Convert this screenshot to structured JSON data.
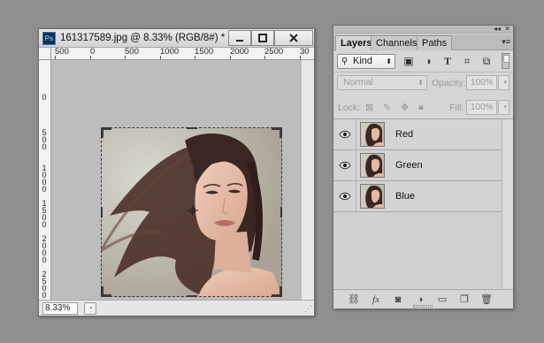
{
  "document": {
    "title": "161317589.jpg @ 8.33% (RGB/8#) *",
    "ruler_h_labels": [
      "500",
      "0",
      "500",
      "1000",
      "1500",
      "2000",
      "2500",
      "30"
    ],
    "ruler_v_labels": [
      "0",
      "500",
      "1000",
      "1500",
      "2000",
      "2500"
    ],
    "zoom": "8.33%"
  },
  "layers_panel": {
    "tabs": [
      "Layers",
      "Channels",
      "Paths"
    ],
    "filter_kind": "Kind",
    "blend_mode": "Normal",
    "opacity_label": "Opacity:",
    "opacity_value": "100%",
    "lock_label": "Lock:",
    "fill_label": "Fill:",
    "fill_value": "100%",
    "layers": [
      {
        "name": "Red",
        "visible": true
      },
      {
        "name": "Green",
        "visible": true
      },
      {
        "name": "Blue",
        "visible": true
      }
    ]
  },
  "colors": {
    "background": "#8f8f8f",
    "panel": "#d6d6d6",
    "photo_hair": "#3a2622",
    "photo_skin": "#e3b9a4"
  }
}
